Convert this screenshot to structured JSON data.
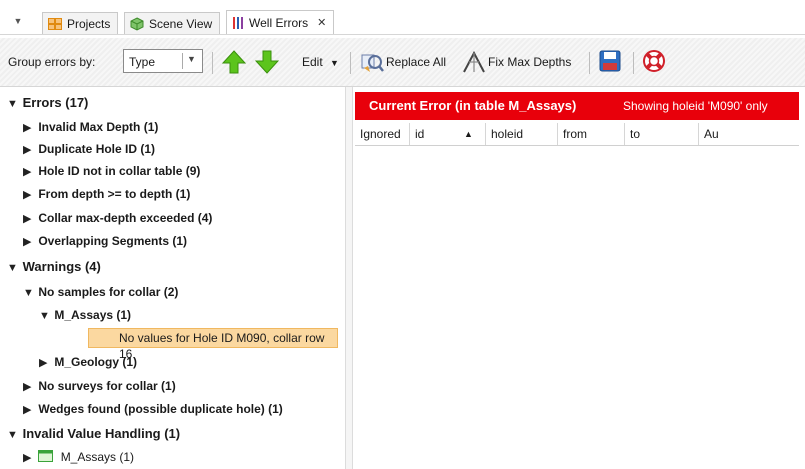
{
  "tabs": [
    {
      "label": "Projects",
      "icon": "projects-icon"
    },
    {
      "label": "Scene View",
      "icon": "scene-view-icon"
    },
    {
      "label": "Well Errors",
      "icon": "well-errors-icon",
      "active": true
    }
  ],
  "toolbar": {
    "group_label": "Group errors by:",
    "group_value": "Type",
    "edit_label": "Edit",
    "replace_all_label": "Replace All",
    "fix_max_depths_label": "Fix Max Depths"
  },
  "tree": {
    "errors": {
      "label": "Errors (17)",
      "items": [
        "Invalid Max Depth (1)",
        "Duplicate Hole ID (1)",
        "Hole ID not in collar table (9)",
        "From depth >= to depth (1)",
        "Collar max-depth exceeded (4)",
        "Overlapping Segments (1)"
      ]
    },
    "warnings": {
      "label": "Warnings (4)",
      "no_samples": "No samples for collar (2)",
      "m_assays": "M_Assays (1)",
      "selected_value": "No values for Hole ID M090, collar row 16",
      "m_geology": "M_Geology (1)",
      "no_surveys": "No surveys for collar (1)",
      "wedges": "Wedges found (possible duplicate hole) (1)"
    },
    "invalid": {
      "label": "Invalid Value Handling (1)",
      "m_assays": "M_Assays (1)"
    }
  },
  "current_error": {
    "title": "Current Error (in table M_Assays)",
    "subtitle": "Showing holeid 'M090' only"
  },
  "table": {
    "columns": [
      "Ignored",
      "id",
      "holeid",
      "from",
      "to",
      "Au"
    ]
  },
  "colors": {
    "error_bar": "#e8000b",
    "selected_row": "#fbd8a0",
    "arrow_green": "#5cc41c"
  }
}
